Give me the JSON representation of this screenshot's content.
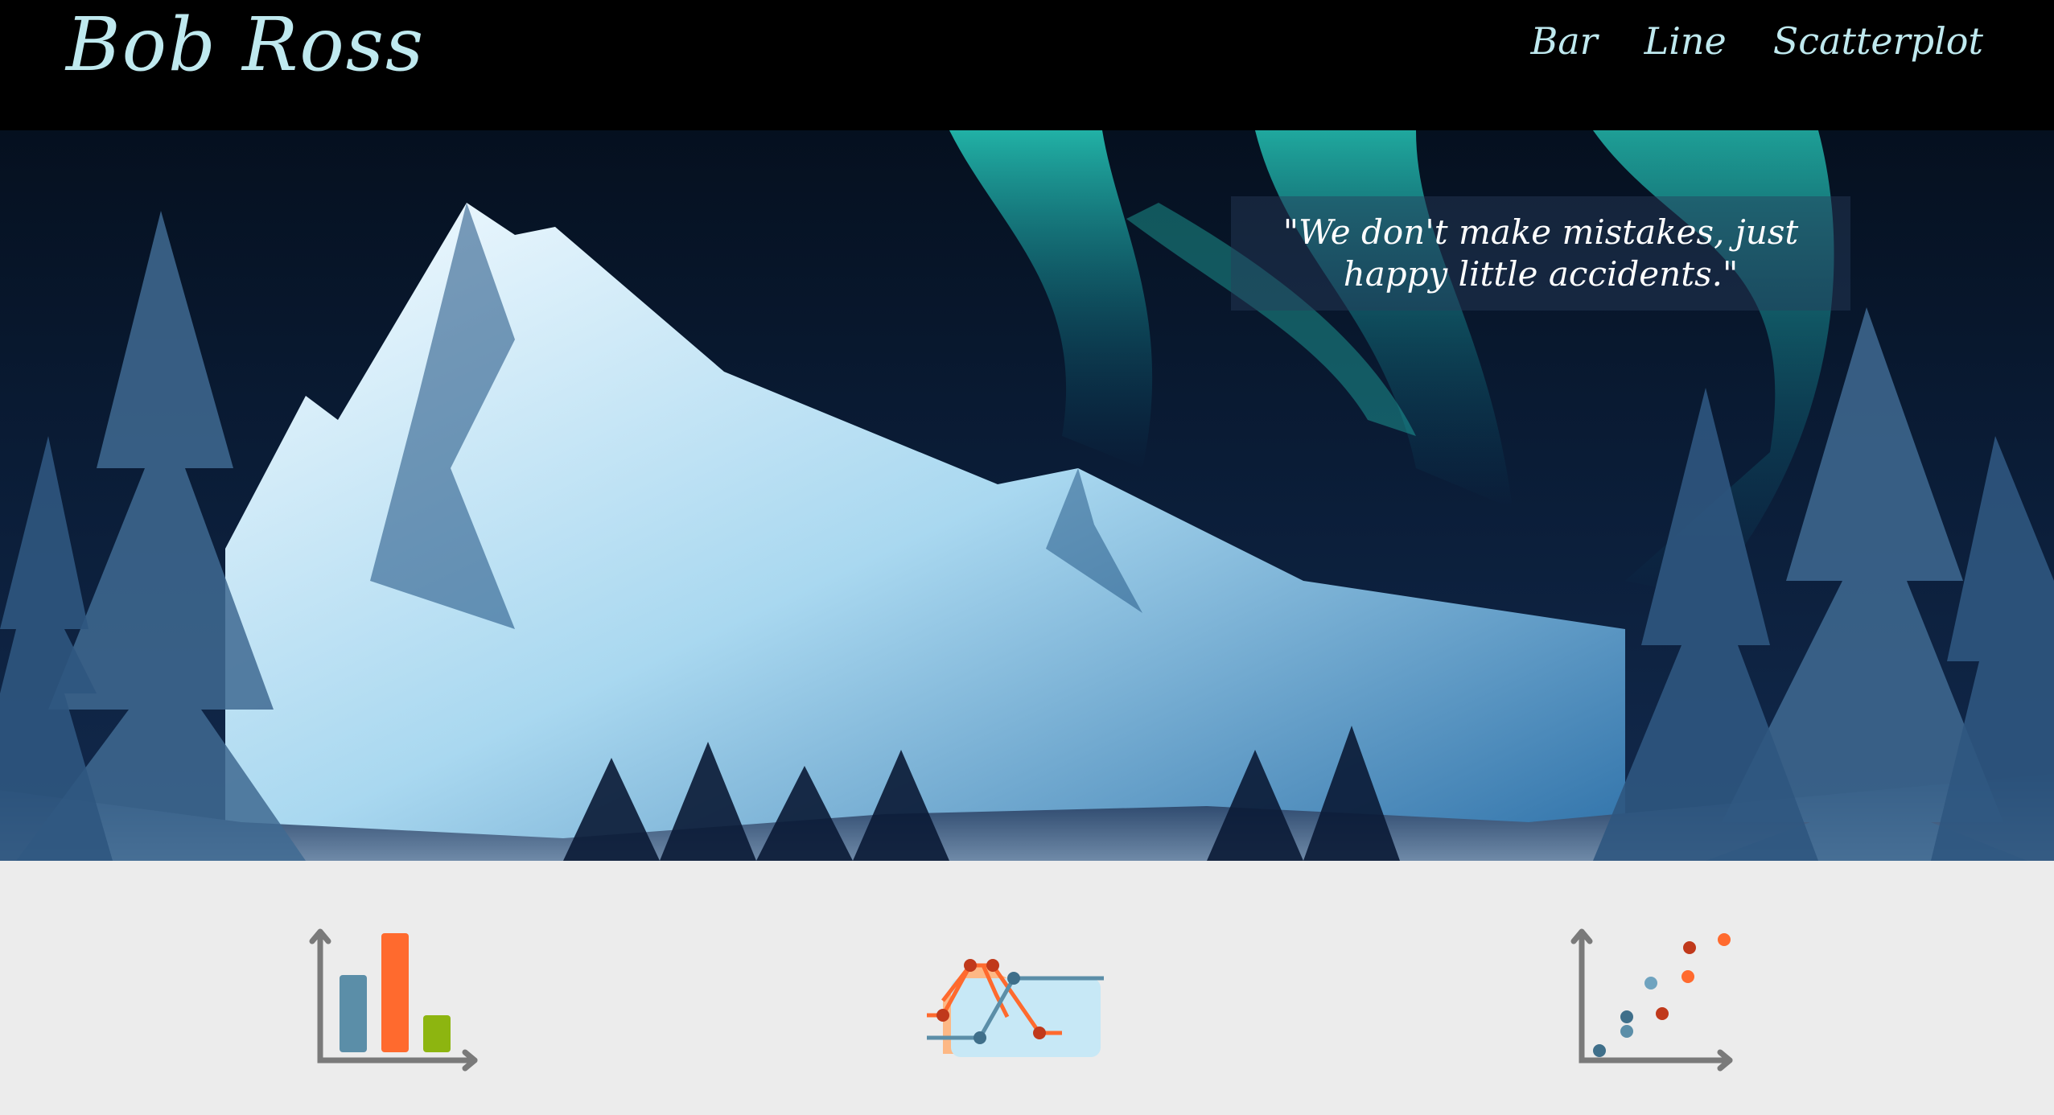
{
  "header": {
    "brand": "Bob Ross",
    "nav": [
      {
        "label": "Bar"
      },
      {
        "label": "Line"
      },
      {
        "label": "Scatterplot"
      }
    ]
  },
  "hero": {
    "quote": "\"We don't make mistakes, just happy little accidents.\""
  },
  "cards": [
    {
      "icon": "bar-chart-icon",
      "caption": ""
    },
    {
      "icon": "line-chart-icon",
      "caption": ""
    },
    {
      "icon": "scatterplot-icon",
      "caption": ""
    }
  ],
  "colors": {
    "accent": "#bfe9ef",
    "orange": "#ff6a2e",
    "blue": "#5b8ea8",
    "green": "#8db510",
    "aurora": "#28d8c6"
  }
}
